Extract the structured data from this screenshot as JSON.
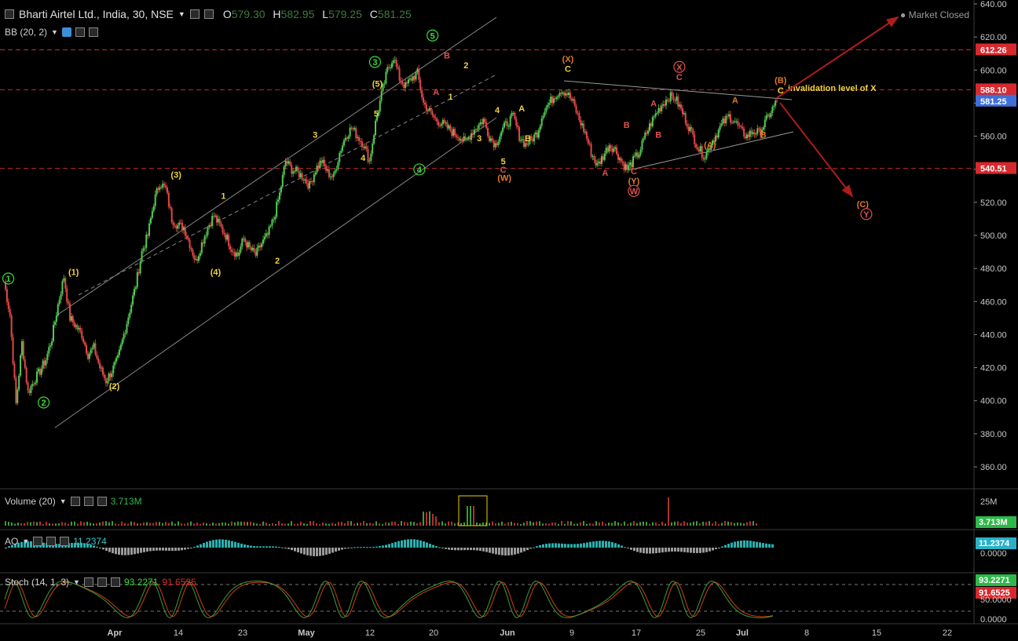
{
  "header": {
    "symbol": "Bharti Airtel Ltd., India, 30, NSE",
    "o_label": "O",
    "o_value": "579.30",
    "h_label": "H",
    "h_value": "582.95",
    "l_label": "L",
    "l_value": "579.25",
    "c_label": "C",
    "c_value": "581.25",
    "indicator": "BB (20, 2)",
    "market_status": "Market Closed"
  },
  "price_axis": {
    "ticks": [
      "640.00",
      "620.00",
      "600.00",
      "580.00",
      "560.00",
      "540.00",
      "520.00",
      "500.00",
      "480.00",
      "460.00",
      "440.00",
      "420.00",
      "400.00",
      "380.00",
      "360.00"
    ],
    "tags": [
      {
        "value": 612.26,
        "label": "612.26",
        "color": "#d8282e"
      },
      {
        "value": 588.1,
        "label": "588.10",
        "color": "#d8282e"
      },
      {
        "value": 581.25,
        "label": "581.25",
        "color": "#3f6fd8"
      },
      {
        "value": 540.51,
        "label": "540.51",
        "color": "#d8282e"
      }
    ]
  },
  "time_axis": {
    "ticks": [
      {
        "label": "Apr",
        "bold": true
      },
      {
        "label": "14",
        "bold": false
      },
      {
        "label": "23",
        "bold": false
      },
      {
        "label": "May",
        "bold": true
      },
      {
        "label": "12",
        "bold": false
      },
      {
        "label": "20",
        "bold": false
      },
      {
        "label": "Jun",
        "bold": true
      },
      {
        "label": "9",
        "bold": false
      },
      {
        "label": "17",
        "bold": false
      },
      {
        "label": "25",
        "bold": false
      },
      {
        "label": "Jul",
        "bold": true
      },
      {
        "label": "8",
        "bold": false
      },
      {
        "label": "15",
        "bold": false
      },
      {
        "label": "22",
        "bold": false
      }
    ]
  },
  "annotations": {
    "invalidation": "invalidation level of X",
    "labels": [
      {
        "text": "1",
        "x": 0.6,
        "y": 472,
        "color": "#3adb3a",
        "circle": true
      },
      {
        "text": "2",
        "x": 6.5,
        "y": 397,
        "color": "#3adb3a",
        "circle": true
      },
      {
        "text": "(1)",
        "x": 11.5,
        "y": 476,
        "color": "#f0d040"
      },
      {
        "text": "(2)",
        "x": 18.3,
        "y": 407,
        "color": "#f0d040"
      },
      {
        "text": "(3)",
        "x": 28.6,
        "y": 535,
        "color": "#f0d040"
      },
      {
        "text": "1",
        "x": 36.5,
        "y": 522,
        "color": "#f0d040"
      },
      {
        "text": "(4)",
        "x": 35.2,
        "y": 476,
        "color": "#f0d040"
      },
      {
        "text": "2",
        "x": 45.5,
        "y": 483,
        "color": "#f0d040"
      },
      {
        "text": "3",
        "x": 51.8,
        "y": 559,
        "color": "#f0d040"
      },
      {
        "text": "4",
        "x": 59.8,
        "y": 545,
        "color": "#f0d040"
      },
      {
        "text": "5",
        "x": 62.0,
        "y": 572,
        "color": "#f0d040"
      },
      {
        "text": "3",
        "x": 61.8,
        "y": 603,
        "color": "#3adb3a",
        "circle": true
      },
      {
        "text": "(5)",
        "x": 62.2,
        "y": 590,
        "color": "#f0d040"
      },
      {
        "text": "4",
        "x": 69.2,
        "y": 538,
        "color": "#3adb3a",
        "circle": true
      },
      {
        "text": "5",
        "x": 71.4,
        "y": 619,
        "color": "#3adb3a",
        "circle": true
      },
      {
        "text": "A",
        "x": 72.0,
        "y": 585,
        "color": "#e05050"
      },
      {
        "text": "B",
        "x": 73.8,
        "y": 607,
        "color": "#e05050"
      },
      {
        "text": "1",
        "x": 74.4,
        "y": 582,
        "color": "#f0d040"
      },
      {
        "text": "2",
        "x": 77.0,
        "y": 601,
        "color": "#f0d040"
      },
      {
        "text": "3",
        "x": 79.2,
        "y": 557,
        "color": "#f0d040"
      },
      {
        "text": "4",
        "x": 82.2,
        "y": 574,
        "color": "#f0d040"
      },
      {
        "text": "5",
        "x": 83.2,
        "y": 543,
        "color": "#f0d040"
      },
      {
        "text": "C",
        "x": 83.2,
        "y": 538,
        "color": "#e05050"
      },
      {
        "text": "(W)",
        "x": 83.4,
        "y": 533,
        "color": "#e07a28"
      },
      {
        "text": "A",
        "x": 86.3,
        "y": 575,
        "color": "#f0d040"
      },
      {
        "text": "B",
        "x": 87.3,
        "y": 557,
        "color": "#f0d040"
      },
      {
        "text": "(X)",
        "x": 94.0,
        "y": 605,
        "color": "#e07a28"
      },
      {
        "text": "C",
        "x": 94.0,
        "y": 599,
        "color": "#f0d040"
      },
      {
        "text": "A",
        "x": 100.2,
        "y": 536,
        "color": "#e05050"
      },
      {
        "text": "B",
        "x": 103.8,
        "y": 565,
        "color": "#e05050"
      },
      {
        "text": "C",
        "x": 105.0,
        "y": 537,
        "color": "#e05050"
      },
      {
        "text": "(Y)",
        "x": 105.0,
        "y": 531,
        "color": "#e07a28"
      },
      {
        "text": "W",
        "x": 105.0,
        "y": 525,
        "color": "#e05050",
        "circle": true
      },
      {
        "text": "A",
        "x": 108.3,
        "y": 578,
        "color": "#e05050"
      },
      {
        "text": "B",
        "x": 109.1,
        "y": 559,
        "color": "#e05050"
      },
      {
        "text": "X",
        "x": 112.6,
        "y": 600,
        "color": "#e05050",
        "circle": true
      },
      {
        "text": "C",
        "x": 112.6,
        "y": 594,
        "color": "#e05050"
      },
      {
        "text": "(A)",
        "x": 117.7,
        "y": 553,
        "color": "#e07a28"
      },
      {
        "text": "A",
        "x": 121.9,
        "y": 580,
        "color": "#e07a28"
      },
      {
        "text": "B",
        "x": 126.6,
        "y": 559,
        "color": "#e07a28"
      },
      {
        "text": "(B)",
        "x": 129.5,
        "y": 592,
        "color": "#e07a28"
      },
      {
        "text": "C",
        "x": 129.5,
        "y": 586,
        "color": "#f0d040"
      },
      {
        "text": "(C)",
        "x": 143.2,
        "y": 517,
        "color": "#e07a28"
      },
      {
        "text": "Y",
        "x": 143.8,
        "y": 511,
        "color": "#e05050",
        "circle": true
      }
    ]
  },
  "chart_data": [
    {
      "type": "line",
      "title": "Bharti Airtel Ltd., India, 30, NSE",
      "xlabel": "",
      "ylabel": "",
      "ylim": [
        350,
        640
      ],
      "x": [
        0,
        1,
        2,
        3,
        4,
        5,
        6,
        7,
        8,
        9,
        10,
        11,
        12,
        13,
        14,
        15,
        16,
        17,
        18,
        19,
        20,
        21,
        22,
        23,
        24,
        25,
        26,
        27,
        28,
        29,
        30,
        31,
        32,
        33,
        34,
        35,
        36,
        37,
        38,
        39,
        40,
        41,
        42,
        43,
        44,
        45,
        46,
        47,
        48,
        49,
        50,
        51,
        52,
        53,
        54,
        55,
        56,
        57,
        58,
        59,
        60,
        61,
        62,
        63,
        64,
        65,
        66,
        67,
        68,
        69,
        70,
        71,
        72,
        73,
        74,
        75,
        76,
        77,
        78,
        79,
        80,
        81,
        82,
        83,
        84,
        85,
        86,
        87,
        88,
        89,
        90,
        91,
        92,
        93,
        94,
        95,
        96,
        97,
        98,
        99,
        100,
        101,
        102,
        103,
        104,
        105,
        106,
        107,
        108,
        109,
        110,
        111,
        112,
        113,
        114,
        115,
        116,
        117,
        118,
        119,
        120,
        121,
        122,
        123,
        124,
        125,
        126,
        127,
        128,
        129
      ],
      "series": [
        {
          "values": [
            472,
            452,
            398,
            435,
            405,
            412,
            418,
            425,
            438,
            458,
            475,
            450,
            445,
            440,
            428,
            432,
            420,
            412,
            418,
            425,
            440,
            455,
            470,
            490,
            500,
            520,
            532,
            528,
            510,
            506,
            505,
            495,
            484,
            495,
            505,
            512,
            506,
            500,
            492,
            488,
            498,
            492,
            488,
            495,
            500,
            510,
            525,
            545,
            540,
            538,
            535,
            530,
            540,
            545,
            538,
            535,
            550,
            560,
            565,
            560,
            555,
            545,
            568,
            585,
            600,
            608,
            595,
            590,
            595,
            598,
            580,
            575,
            570,
            568,
            565,
            562,
            560,
            556,
            562,
            566,
            570,
            560,
            555,
            563,
            568,
            572,
            560,
            555,
            558,
            562,
            575,
            580,
            585,
            588,
            586,
            580,
            570,
            562,
            550,
            542,
            548,
            555,
            552,
            545,
            540,
            545,
            550,
            560,
            568,
            575,
            580,
            584,
            583,
            576,
            568,
            560,
            552,
            548,
            556,
            562,
            568,
            572,
            569,
            563,
            560,
            563,
            562,
            568,
            575,
            581
          ]
        }
      ]
    },
    {
      "type": "bar",
      "title": "Volume (20)",
      "value_label": "3.713M",
      "scale_label": "25M",
      "note": "volume bars, last 3.713M"
    },
    {
      "type": "bar",
      "title": "AO",
      "value_label": "11.2374",
      "scale_label": "0.0000"
    },
    {
      "type": "line",
      "title": "Stoch (14, 1, 3)",
      "series": [
        {
          "name": "93.2271",
          "color": "#3a9d3a"
        },
        {
          "name": "91.6525",
          "color": "#d04010"
        }
      ],
      "axis_labels": [
        "93.2271",
        "91.6525",
        "50.0000",
        "0.0000"
      ]
    }
  ],
  "panes": {
    "volume_label": "Volume (20)",
    "volume_value": "3.713M",
    "volume_axis": "25M",
    "ao_label": "AO",
    "ao_value": "11.2374",
    "ao_axis": "0.0000",
    "stoch_label": "Stoch (14, 1, 3)",
    "stoch_k": "93.2271",
    "stoch_d": "91.6525",
    "stoch_axis_mid": "50.0000",
    "stoch_axis_low": "0.0000"
  }
}
